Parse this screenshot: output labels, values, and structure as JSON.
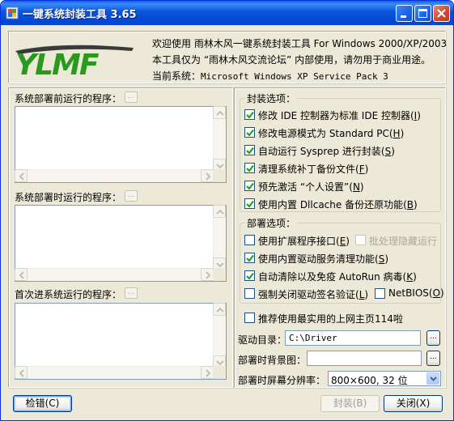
{
  "window": {
    "title": "一键系统封装工具 3.65"
  },
  "header": {
    "logo_text": "YLMF",
    "welcome_prefix": "欢迎使用 雨林木风一键系统封装工具 For Windows 2000/XP/2003",
    "notice": "本工具仅为 “雨林木风交流论坛” 内部使用，请勿用于商业用途。",
    "current_system_label": "当前系统：",
    "current_system_value": "Microsoft Windows XP Service Pack 3"
  },
  "programs": {
    "before_label": "系统部署前运行的程序：",
    "during_label": "系统部署时运行的程序：",
    "first_boot_label": "首次进系统运行的程序：",
    "add_button": "..."
  },
  "package_options": {
    "title": "封装选项：",
    "items": [
      {
        "label": "修改 IDE 控制器为标准 IDE 控制器",
        "key": "I",
        "checked": true
      },
      {
        "label": "修改电源模式为 Standard PC",
        "key": "H",
        "checked": true
      },
      {
        "label": "自动运行 Sysprep 进行封装",
        "key": "S",
        "checked": true
      },
      {
        "label": "清理系统补丁备份文件",
        "key": "F",
        "checked": true
      },
      {
        "label": "预先激活 “个人设置”",
        "key": "N",
        "checked": true
      },
      {
        "label": "使用内置 Dllcache 备份还原功能",
        "key": "B",
        "checked": true
      }
    ]
  },
  "deploy_options": {
    "title": "部署选项：",
    "ext_interface": {
      "label": "使用扩展程序接口",
      "key": "E",
      "checked": false
    },
    "batch_hidden": {
      "label": "批处理隐藏运行",
      "checked": false
    },
    "driver_cleanup": {
      "label": "使用内置驱动服务清理功能",
      "key": "S",
      "checked": true
    },
    "autorun_clean": {
      "label": "自动清除以及免疫 AutoRun 病毒",
      "key": "K",
      "checked": true
    },
    "force_disable_sign": {
      "label": "强制关闭驱动签名验证",
      "key": "L",
      "checked": false
    },
    "netbios": {
      "label": "NetBIOS",
      "key": "O",
      "checked": false
    }
  },
  "homepage": {
    "label": "推荐使用最实用的上网主页114啦",
    "checked": false
  },
  "fields": {
    "driver_dir_label": "驱动目录：",
    "driver_dir_value": "C:\\Driver",
    "background_label": "部署时背景图：",
    "background_value": "",
    "resolution_label": "部署时屏幕分辨率：",
    "resolution_value": "800×600, 32 位",
    "browse": "..."
  },
  "buttons": {
    "check": "检错(C)",
    "package": "封装(B)",
    "close": "关闭(X)"
  },
  "colors": {
    "titlebar": "#0855dd",
    "dialog_bg": "#ece9d8",
    "check_green": "#21a121",
    "logo_green": "#2a9a1e"
  }
}
